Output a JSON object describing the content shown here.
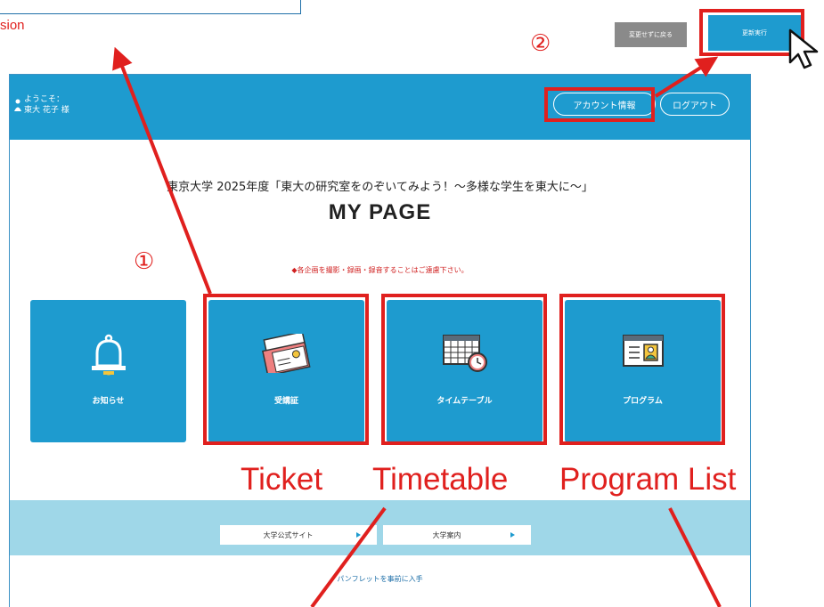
{
  "top": {
    "cut_label": "sion",
    "back_button": "変更せずに戻る",
    "update_button": "更新実行",
    "marker_2": "②"
  },
  "header": {
    "welcome_line1": "ようこそ：",
    "welcome_line2": "東大 花子 様",
    "account_button": "アカウント情報",
    "logout_button": "ログアウト"
  },
  "main": {
    "event_title": "東京大学 2025年度「東大の研究室をのぞいてみよう！〜多様な学生を東大に〜」",
    "page_title": "MY PAGE",
    "notice": "◆各企画を撮影・録画・録音することはご遠慮下さい。",
    "marker_1": "①",
    "tiles": [
      {
        "label": "お知らせ",
        "icon": "bell-icon"
      },
      {
        "label": "受講証",
        "icon": "ticket-icon"
      },
      {
        "label": "タイムテーブル",
        "icon": "calendar-clock-icon"
      },
      {
        "label": "プログラム",
        "icon": "program-window-icon"
      }
    ]
  },
  "links": {
    "official_site": "大学公式サイト",
    "university_guide": "大学案内",
    "pamphlet": "パンフレットを事前に入手"
  },
  "annotations": {
    "ticket": "Ticket",
    "timetable": "Timetable",
    "program_list": "Program List"
  },
  "colors": {
    "brand_blue": "#1e9bcf",
    "light_band": "#9fd7e8",
    "annotation_red": "#e0201e"
  }
}
